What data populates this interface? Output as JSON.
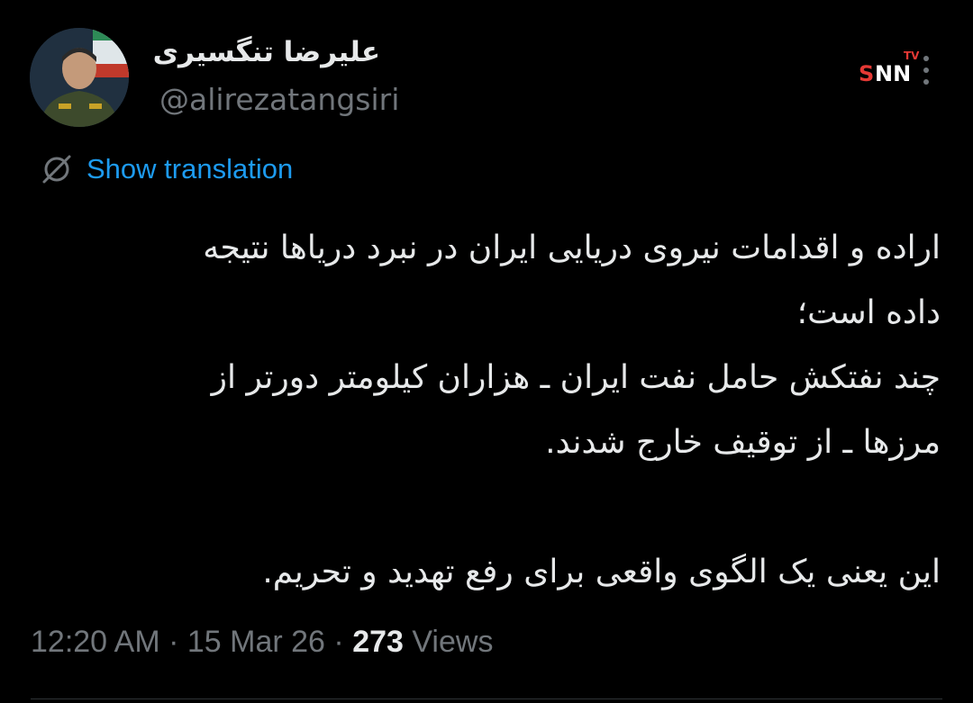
{
  "author": {
    "display_name": "علیرضا تنگسیری",
    "handle": "@alirezatangsiri"
  },
  "watermark": {
    "tv": "TV",
    "s": "S",
    "nn": "NN"
  },
  "translate": {
    "label": "Show translation",
    "icon": "globe-slash-icon"
  },
  "tweet": {
    "lines": [
      "اراده و اقدامات نیروی دریایی ایران در نبرد دریاها نتیجه",
      "داده است؛",
      "چند نفتکش حامل نفت ایران ـ هزاران کیلومتر دورتر از",
      "مرزها ـ از توقیف خارج شدند.",
      "",
      "این یعنی یک الگوی واقعی برای رفع تهدید و تحریم."
    ]
  },
  "meta": {
    "time": "12:20 AM",
    "sep1": " · ",
    "date": "15 Mar 26",
    "sep2": " · ",
    "views_count": "273",
    "views_label": " Views"
  },
  "colors": {
    "background": "#000000",
    "text": "#e7e9ea",
    "muted": "#71767b",
    "link": "#1d9bf0",
    "brand_red": "#e53935"
  }
}
